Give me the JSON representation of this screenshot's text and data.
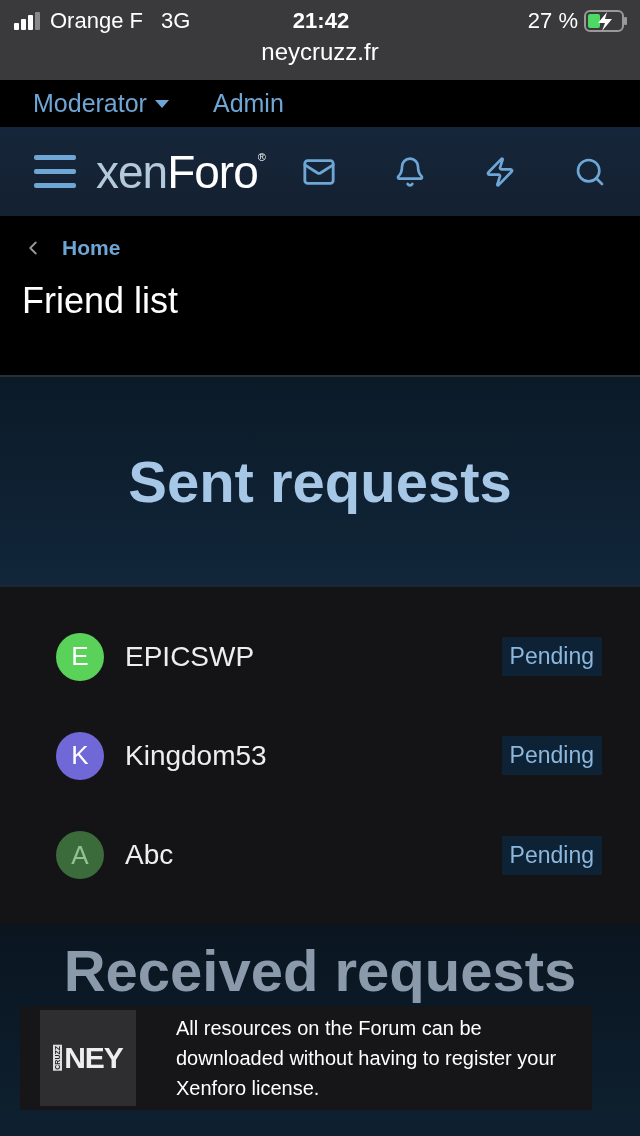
{
  "status_bar": {
    "carrier": "Orange F",
    "network": "3G",
    "time": "21:42",
    "battery": "27 %"
  },
  "browser": {
    "address": "neycruzz.fr"
  },
  "top_nav": [
    {
      "label": "Moderator",
      "has_menu": true
    },
    {
      "label": "Admin",
      "has_menu": false
    }
  ],
  "header": {
    "logo_main": "xen",
    "logo_accent": "Foro",
    "logo_mark": "®"
  },
  "breadcrumb": {
    "label": "Home"
  },
  "page_title": "Friend list",
  "sent_section": {
    "title": "Sent requests",
    "requests": [
      {
        "initial": "E",
        "name": "EPICSWP",
        "status": "Pending",
        "color": "#5ad25a"
      },
      {
        "initial": "K",
        "name": "Kingdom53",
        "status": "Pending",
        "color": "#7168d8"
      },
      {
        "initial": "A",
        "name": "Abc",
        "status": "Pending",
        "color": "#3b6b3b"
      }
    ]
  },
  "received_section": {
    "title": "Received requests"
  },
  "notice": {
    "logo_small": "CRUZZ",
    "logo_big": "NEY",
    "text": "All resources on the Forum can be downloaded without having to register your Xenforo license."
  }
}
